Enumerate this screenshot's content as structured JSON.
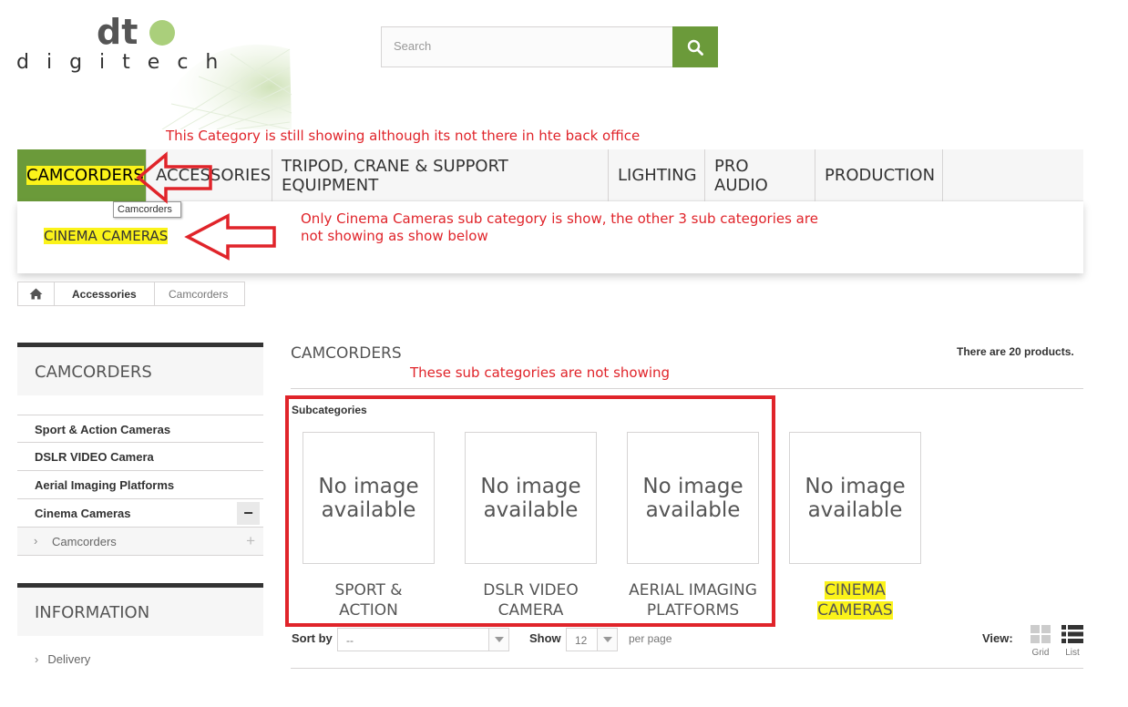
{
  "brand": {
    "name": "digitech",
    "mark": "dt"
  },
  "search": {
    "placeholder": "Search"
  },
  "annotations": {
    "category_note": "This Category is still showing although its not there in hte back office",
    "subcat_note_1": "Only Cinema Cameras sub category is show, the other 3 sub categories are",
    "subcat_note_2": "not showing as show below",
    "box_note": "These sub categories are not showing"
  },
  "menu": {
    "items": [
      {
        "label": "CAMCORDERS"
      },
      {
        "label": "ACCESSORIES"
      },
      {
        "label": "TRIPOD, CRANE & SUPPORT EQUIPMENT"
      },
      {
        "label": "LIGHTING"
      },
      {
        "label": "PRO AUDIO"
      },
      {
        "label": "PRODUCTION"
      }
    ],
    "tooltip": "Camcorders",
    "dropdown_item": "CINEMA CAMERAS"
  },
  "breadcrumb": {
    "items": [
      "Accessories",
      "Camcorders"
    ]
  },
  "sidebar": {
    "title": "CAMCORDERS",
    "items": [
      {
        "label": "Sport & Action Cameras"
      },
      {
        "label": "DSLR VIDEO Camera"
      },
      {
        "label": "Aerial Imaging Platforms"
      },
      {
        "label": "Cinema Cameras",
        "toggle": "−"
      }
    ],
    "subitem": {
      "label": "Camcorders",
      "toggle": "+"
    },
    "info_title": "INFORMATION",
    "info_items": [
      {
        "label": "Delivery"
      }
    ]
  },
  "main": {
    "title": "CAMCORDERS",
    "count": "There are 20 products.",
    "subcategories_label": "Subcategories",
    "no_image_line1": "No image",
    "no_image_line2": "available",
    "subcategories": [
      {
        "line1": "SPORT &",
        "line2": "ACTION"
      },
      {
        "line1": "DSLR VIDEO",
        "line2": "CAMERA"
      },
      {
        "line1": "AERIAL IMAGING",
        "line2": "PLATFORMS"
      },
      {
        "line1": "CINEMA",
        "line2": "CAMERAS"
      }
    ],
    "sort_label": "Sort by",
    "sort_value": "--",
    "show_label": "Show",
    "show_value": "12",
    "per_page": "per page",
    "view_label": "View:",
    "grid_label": "Grid",
    "list_label": "List"
  },
  "colors": {
    "accent": "#6b9a3a",
    "annotation": "#e0242a",
    "highlight": "#fbf31a"
  }
}
